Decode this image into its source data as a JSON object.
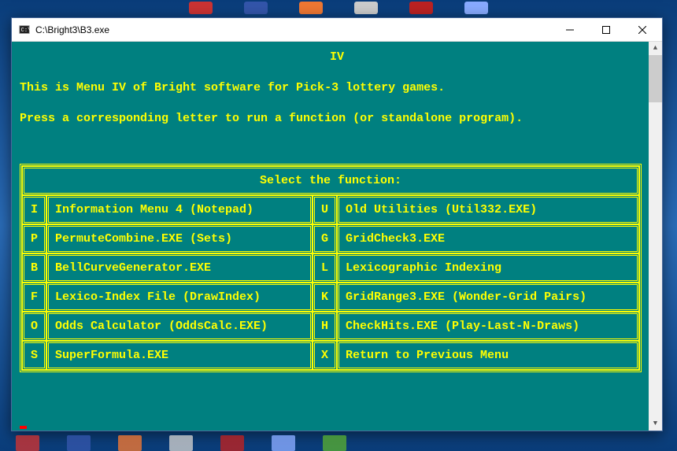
{
  "window": {
    "title": "C:\\Bright3\\B3.exe"
  },
  "console": {
    "heading": "IV",
    "line1": "This is Menu IV of Bright software for Pick-3 lottery games.",
    "line2": "Press a corresponding letter to run a function (or standalone program).",
    "menu_title": "Select the function:",
    "rows": [
      {
        "k1": "I",
        "d1": "Information Menu 4 (Notepad)",
        "k2": "U",
        "d2": "Old Utilities (Util332.EXE)"
      },
      {
        "k1": "P",
        "d1": "PermuteCombine.EXE (Sets)",
        "k2": "G",
        "d2": "GridCheck3.EXE"
      },
      {
        "k1": "B",
        "d1": "BellCurveGenerator.EXE",
        "k2": "L",
        "d2": "Lexicographic Indexing"
      },
      {
        "k1": "F",
        "d1": "Lexico-Index File (DrawIndex)",
        "k2": "K",
        "d2": "GridRange3.EXE (Wonder-Grid Pairs)"
      },
      {
        "k1": "O",
        "d1": "Odds Calculator (OddsCalc.EXE)",
        "k2": "H",
        "d2": "CheckHits.EXE (Play-Last-N-Draws)"
      },
      {
        "k1": "S",
        "d1": "SuperFormula.EXE",
        "k2": "X",
        "d2": "Return to Previous Menu"
      }
    ]
  }
}
